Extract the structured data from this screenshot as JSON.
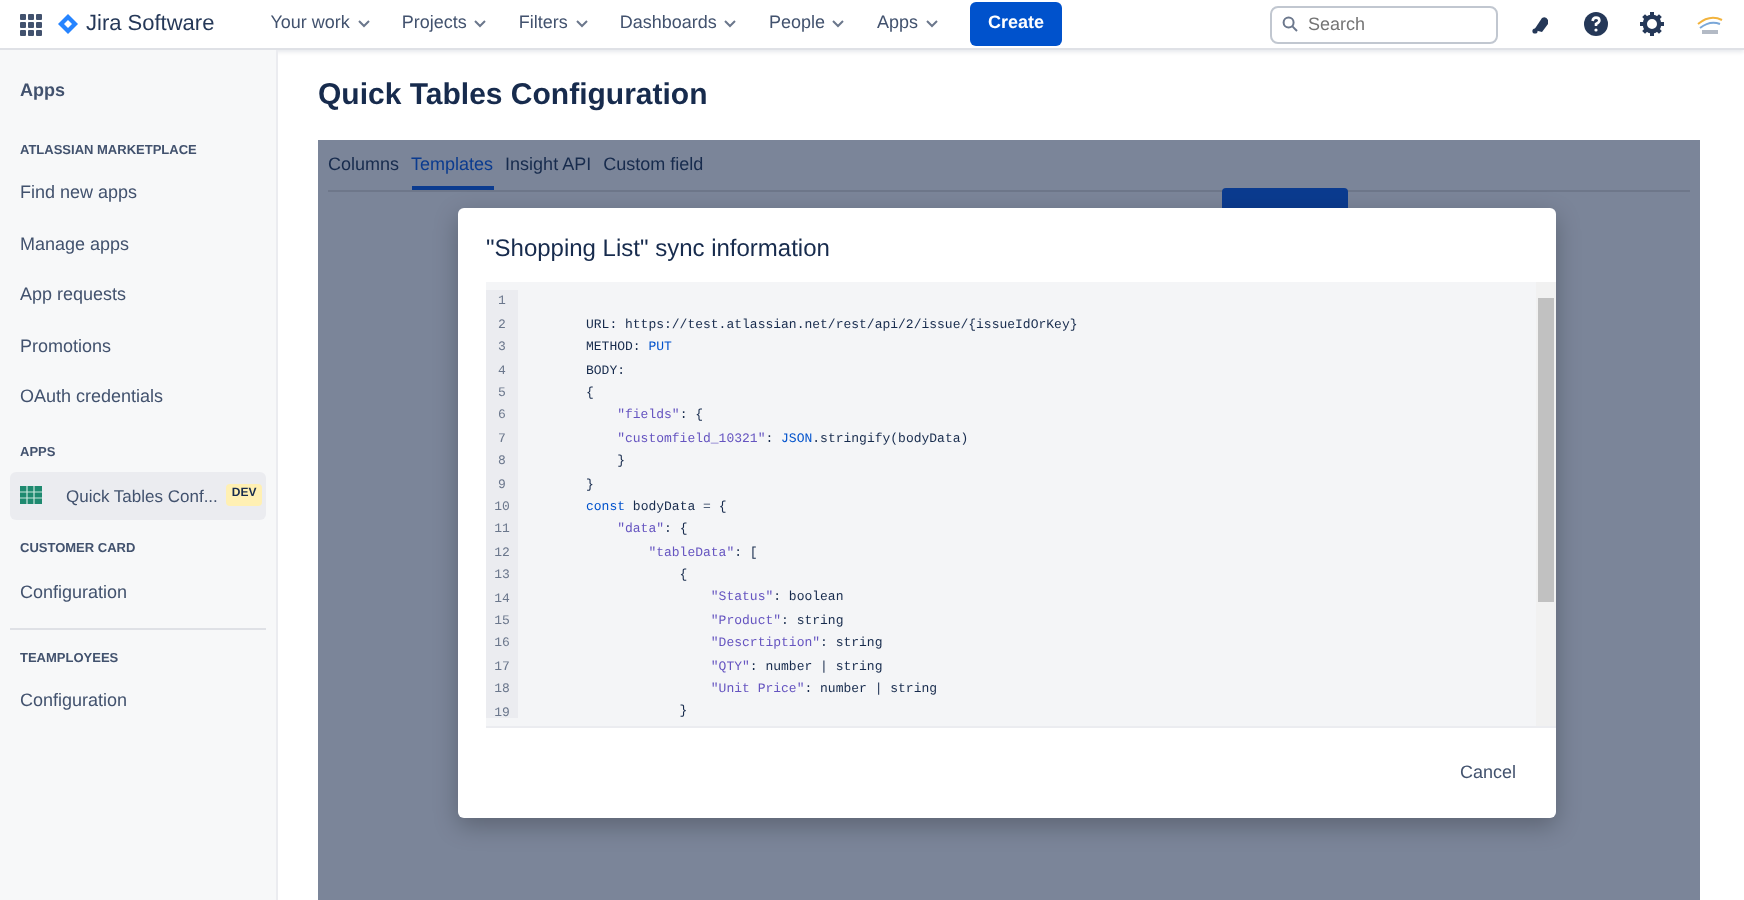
{
  "navbar": {
    "product": "Jira Software",
    "menus": [
      {
        "label": "Your work"
      },
      {
        "label": "Projects"
      },
      {
        "label": "Filters"
      },
      {
        "label": "Dashboards"
      },
      {
        "label": "People"
      },
      {
        "label": "Apps"
      }
    ],
    "create": "Create",
    "search": {
      "placeholder": "Search"
    }
  },
  "sidebar": {
    "title": "Apps",
    "sections": [
      {
        "heading": "ATLASSIAN MARKETPLACE",
        "items": [
          {
            "label": "Find new apps",
            "selected": false
          },
          {
            "label": "Manage apps",
            "selected": false
          },
          {
            "label": "App requests",
            "selected": false
          },
          {
            "label": "Promotions",
            "selected": false
          },
          {
            "label": "OAuth credentials",
            "selected": false
          }
        ]
      },
      {
        "heading": "APPS",
        "items": [
          {
            "label": "Quick Tables Conf...",
            "badge": "DEV",
            "selected": true
          }
        ]
      },
      {
        "heading": "CUSTOMER CARD",
        "items": [
          {
            "label": "Configuration",
            "selected": false
          }
        ]
      },
      {
        "heading": "TEAMPLOYEES",
        "items": [
          {
            "label": "Configuration",
            "selected": false
          }
        ]
      }
    ]
  },
  "page": {
    "title": "Quick Tables Configuration",
    "tabs": [
      {
        "label": "Columns",
        "selected": false
      },
      {
        "label": "Templates",
        "selected": true
      },
      {
        "label": "Insight API",
        "selected": false
      },
      {
        "label": "Custom field",
        "selected": false
      }
    ]
  },
  "modal": {
    "title": "\"Shopping List\" sync information",
    "code_lines": [
      {
        "number": "1"
      },
      {
        "number": "2",
        "segments": [
          {
            "text": "URL: https://test.atlassian.net/rest/api/2/issue/{issueIdOrKey}",
            "kind": "plain"
          }
        ]
      },
      {
        "number": "3",
        "segments": [
          {
            "text": "METHOD: ",
            "kind": "plain"
          },
          {
            "text": "PUT",
            "kind": "keyword"
          }
        ]
      },
      {
        "number": "4",
        "segments": [
          {
            "text": "BODY:",
            "kind": "plain"
          }
        ]
      },
      {
        "number": "5",
        "segments": [
          {
            "text": "{",
            "kind": "plain"
          }
        ]
      },
      {
        "number": "6",
        "segments": [
          {
            "text": "    \"fields\"",
            "kind": "string"
          },
          {
            "text": ": {",
            "kind": "plain"
          }
        ]
      },
      {
        "number": "7",
        "segments": [
          {
            "text": "    \"customfield_10321\"",
            "kind": "string"
          },
          {
            "text": ": ",
            "kind": "plain"
          },
          {
            "text": "JSON",
            "kind": "keyword"
          },
          {
            "text": ".stringify(bodyData)",
            "kind": "plain"
          }
        ]
      },
      {
        "number": "8",
        "segments": [
          {
            "text": "    }",
            "kind": "plain"
          }
        ]
      },
      {
        "number": "9",
        "segments": [
          {
            "text": "}",
            "kind": "plain"
          }
        ]
      },
      {
        "number": "10",
        "segments": [
          {
            "text": "const",
            "kind": "keyword"
          },
          {
            "text": " bodyData = {",
            "kind": "plain"
          }
        ]
      },
      {
        "number": "11",
        "segments": [
          {
            "text": "    \"data\"",
            "kind": "string"
          },
          {
            "text": ": {",
            "kind": "plain"
          }
        ]
      },
      {
        "number": "12",
        "segments": [
          {
            "text": "        \"tableData\"",
            "kind": "string"
          },
          {
            "text": ": [",
            "kind": "plain"
          }
        ]
      },
      {
        "number": "13",
        "segments": [
          {
            "text": "            {",
            "kind": "plain"
          }
        ]
      },
      {
        "number": "14",
        "segments": [
          {
            "text": "                \"Status\"",
            "kind": "string"
          },
          {
            "text": ": boolean",
            "kind": "plain"
          }
        ]
      },
      {
        "number": "15",
        "segments": [
          {
            "text": "                \"Product\"",
            "kind": "string"
          },
          {
            "text": ": string",
            "kind": "plain"
          }
        ]
      },
      {
        "number": "16",
        "segments": [
          {
            "text": "                \"Descrtiption\"",
            "kind": "string"
          },
          {
            "text": ": string",
            "kind": "plain"
          }
        ]
      },
      {
        "number": "17",
        "segments": [
          {
            "text": "                \"QTY\"",
            "kind": "string"
          },
          {
            "text": ": number | string",
            "kind": "plain"
          }
        ]
      },
      {
        "number": "18",
        "segments": [
          {
            "text": "                \"Unit Price\"",
            "kind": "string"
          },
          {
            "text": ": number | string",
            "kind": "plain"
          }
        ]
      },
      {
        "number": "19",
        "segments": [
          {
            "text": "            }",
            "kind": "plain"
          }
        ]
      }
    ],
    "cancel": "Cancel"
  }
}
